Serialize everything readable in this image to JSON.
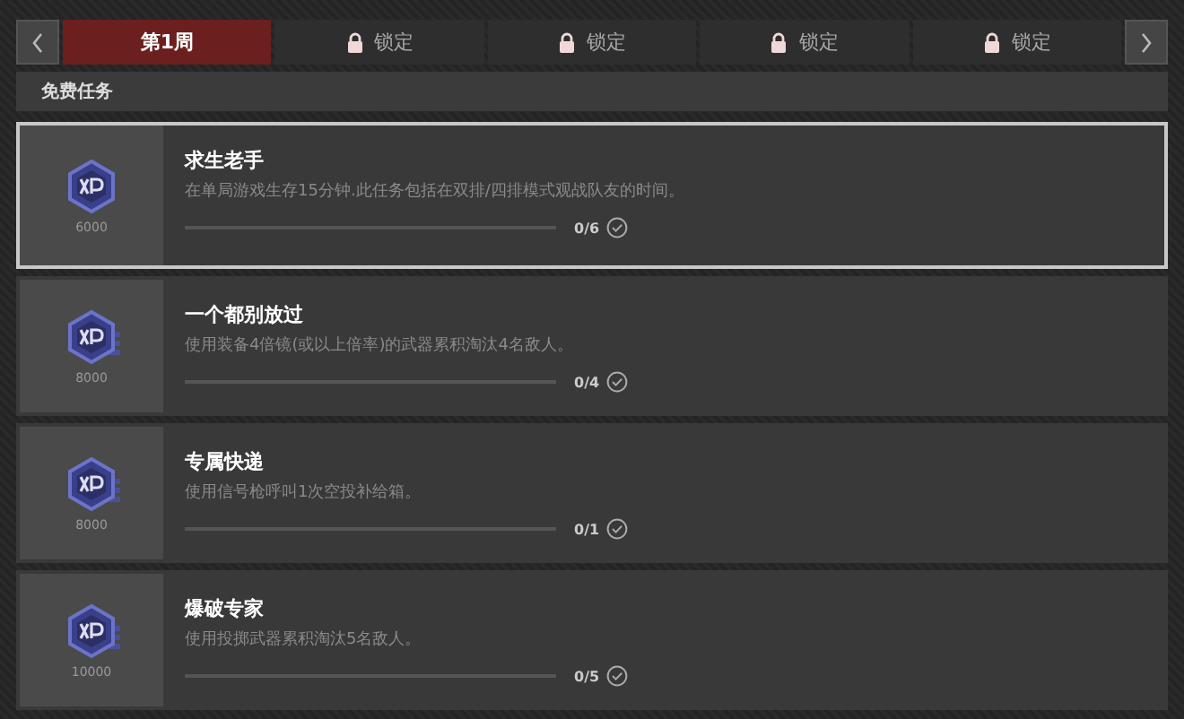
{
  "tabs": [
    {
      "label": "第1周",
      "selected": true,
      "locked": false
    },
    {
      "label": "锁定",
      "selected": false,
      "locked": true
    },
    {
      "label": "锁定",
      "selected": false,
      "locked": true
    },
    {
      "label": "锁定",
      "selected": false,
      "locked": true
    },
    {
      "label": "锁定",
      "selected": false,
      "locked": true
    }
  ],
  "section": {
    "title": "免费任务"
  },
  "missions": [
    {
      "title": "求生老手",
      "description": "在单局游戏生存15分钟.此任务包括在双排/四排模式观战队友的时间。",
      "reward": "6000",
      "kind": "single",
      "progress": "0/6",
      "level": 0,
      "selected": true
    },
    {
      "title": "一个都别放过",
      "description": "使用装备4倍镜(或以上倍率)的武器累积淘汰4名敌人。",
      "reward": "8000",
      "kind": "stack",
      "progress": "0/4",
      "level": 0,
      "selected": false
    },
    {
      "title": "专属快递",
      "description": "使用信号枪呼叫1次空投补给箱。",
      "reward": "8000",
      "kind": "stack",
      "progress": "0/1",
      "level": 0,
      "selected": false
    },
    {
      "title": "爆破专家",
      "description": "使用投掷武器累积淘汰5名敌人。",
      "reward": "10000",
      "kind": "stack",
      "progress": "0/5",
      "level": 0,
      "selected": false
    }
  ]
}
